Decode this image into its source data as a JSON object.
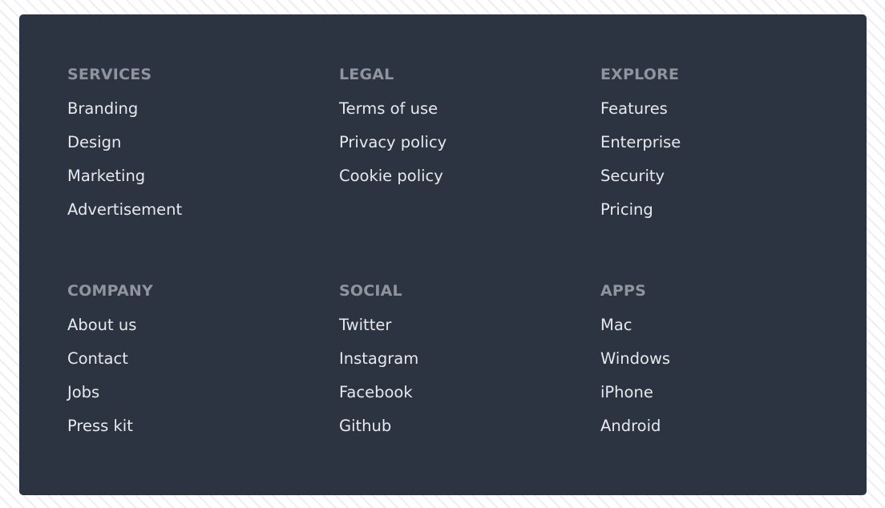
{
  "sections": [
    {
      "title": "SERVICES",
      "links": [
        "Branding",
        "Design",
        "Marketing",
        "Advertisement"
      ]
    },
    {
      "title": "LEGAL",
      "links": [
        "Terms of use",
        "Privacy policy",
        "Cookie policy"
      ]
    },
    {
      "title": "EXPLORE",
      "links": [
        "Features",
        "Enterprise",
        "Security",
        "Pricing"
      ]
    },
    {
      "title": "COMPANY",
      "links": [
        "About us",
        "Contact",
        "Jobs",
        "Press kit"
      ]
    },
    {
      "title": "SOCIAL",
      "links": [
        "Twitter",
        "Instagram",
        "Facebook",
        "Github"
      ]
    },
    {
      "title": "APPS",
      "links": [
        "Mac",
        "Windows",
        "iPhone",
        "Android"
      ]
    }
  ]
}
